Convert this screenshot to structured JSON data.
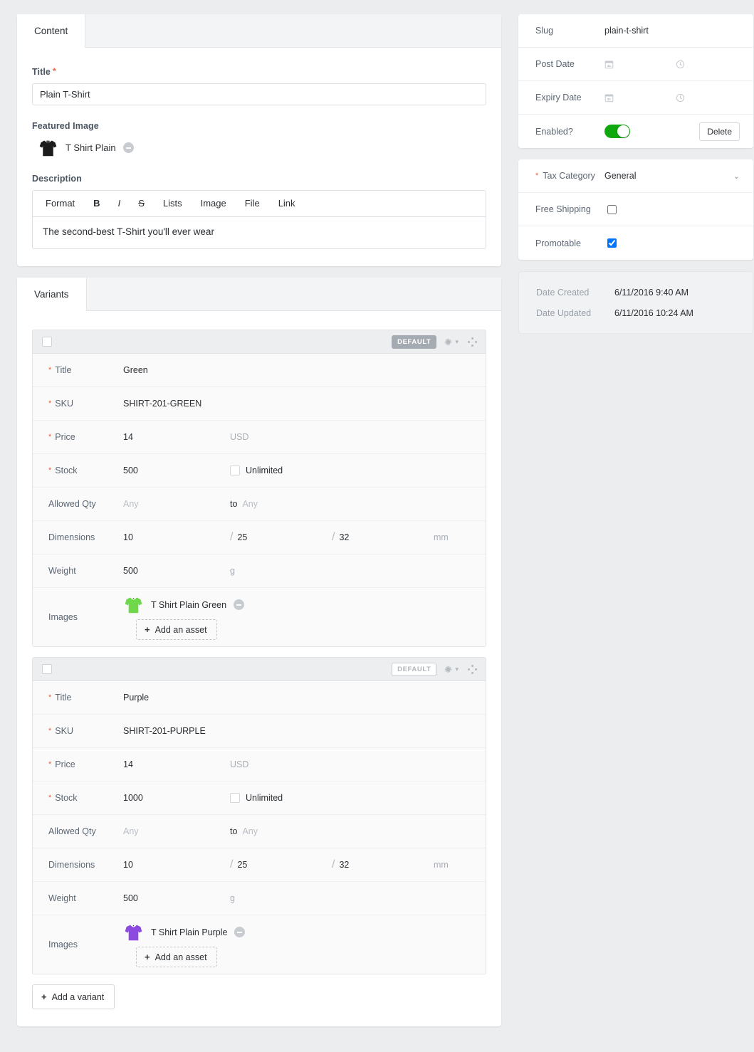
{
  "content_panel": {
    "tab_label": "Content",
    "title_field": {
      "label": "Title",
      "required": true,
      "value": "Plain T-Shirt"
    },
    "featured_image": {
      "label": "Featured Image",
      "asset_name": "T Shirt Plain",
      "remove_icon": "minus-circle-icon",
      "thumbnail": "black-tshirt-thumbnail"
    },
    "description": {
      "label": "Description",
      "toolbar": [
        {
          "label": "Format",
          "name": "format"
        },
        {
          "label": "B",
          "name": "bold"
        },
        {
          "label": "I",
          "name": "italic"
        },
        {
          "label": "S",
          "name": "strikethrough"
        },
        {
          "label": "Lists",
          "name": "lists"
        },
        {
          "label": "Image",
          "name": "image"
        },
        {
          "label": "File",
          "name": "file"
        },
        {
          "label": "Link",
          "name": "link"
        }
      ],
      "body_text": "The second-best T-Shirt you'll ever wear"
    }
  },
  "variants_panel": {
    "tab_label": "Variants",
    "add_variant_label": "Add a variant",
    "add_asset_label": "Add an asset",
    "default_badge_label": "DEFAULT",
    "row_labels": {
      "title": "Title",
      "sku": "SKU",
      "price": "Price",
      "stock": "Stock",
      "allowed_qty": "Allowed Qty",
      "dimensions": "Dimensions",
      "weight": "Weight",
      "images": "Images"
    },
    "unlimited_label": "Unlimited",
    "qty_to_label": "to",
    "qty_placeholder": "Any",
    "variants": [
      {
        "is_default_selected": true,
        "title": "Green",
        "sku": "SHIRT-201-GREEN",
        "price": "14",
        "currency": "USD",
        "stock": "500",
        "unlimited": false,
        "allowed_qty_min": "Any",
        "allowed_qty_max": "Any",
        "dim_w": "10",
        "dim_h": "25",
        "dim_d": "32",
        "dim_unit": "mm",
        "weight": "500",
        "weight_unit": "g",
        "image_name": "T Shirt Plain Green",
        "image_color": "#6ed84a"
      },
      {
        "is_default_selected": false,
        "title": "Purple",
        "sku": "SHIRT-201-PURPLE",
        "price": "14",
        "currency": "USD",
        "stock": "1000",
        "unlimited": false,
        "allowed_qty_min": "Any",
        "allowed_qty_max": "Any",
        "dim_w": "10",
        "dim_h": "25",
        "dim_d": "32",
        "dim_unit": "mm",
        "weight": "500",
        "weight_unit": "g",
        "image_name": "T Shirt Plain Purple",
        "image_color": "#8c4ae0"
      }
    ]
  },
  "sidebar": {
    "settings": {
      "slug_label": "Slug",
      "slug_value": "plain-t-shirt",
      "post_date_label": "Post Date",
      "expiry_date_label": "Expiry Date",
      "enabled_label": "Enabled?",
      "enabled_value": true,
      "delete_label": "Delete",
      "calendar_icon": "calendar-icon",
      "clock_icon": "clock-icon"
    },
    "commerce": {
      "tax_category_label": "Tax Category",
      "tax_category_value": "General",
      "tax_category_required": true,
      "free_shipping_label": "Free Shipping",
      "free_shipping_checked": false,
      "promotable_label": "Promotable",
      "promotable_checked": true
    },
    "meta": {
      "date_created_label": "Date Created",
      "date_created_value": "6/11/2016 9:40 AM",
      "date_updated_label": "Date Updated",
      "date_updated_value": "6/11/2016 10:24 AM"
    }
  },
  "colors": {
    "page_bg": "#ebedef",
    "accent_required": "#e8603c",
    "toggle_on": "#0fa80f",
    "badge_filled": "#a5abb2"
  }
}
